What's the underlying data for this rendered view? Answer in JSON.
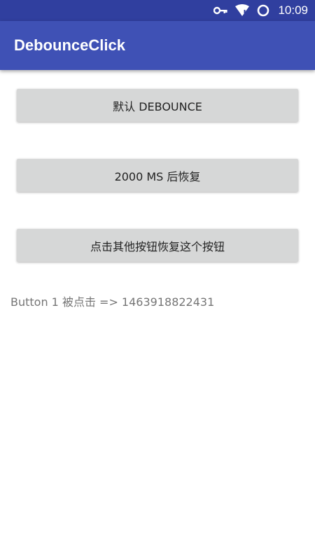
{
  "status_bar": {
    "time": "10:09",
    "icons": [
      "key-icon",
      "wifi-icon",
      "sync-icon"
    ]
  },
  "app_bar": {
    "title": "DebounceClick"
  },
  "buttons": [
    {
      "label": "默认 DEBOUNCE"
    },
    {
      "label": "2000 MS 后恢复"
    },
    {
      "label": "点击其他按钮恢复这个按钮"
    }
  ],
  "log": {
    "text": "Button 1 被点击 => 1463918822431"
  },
  "colors": {
    "status_bar": "#303f9f",
    "app_bar": "#3f51b5",
    "button_bg": "#d6d7d7",
    "log_text": "#757575"
  }
}
